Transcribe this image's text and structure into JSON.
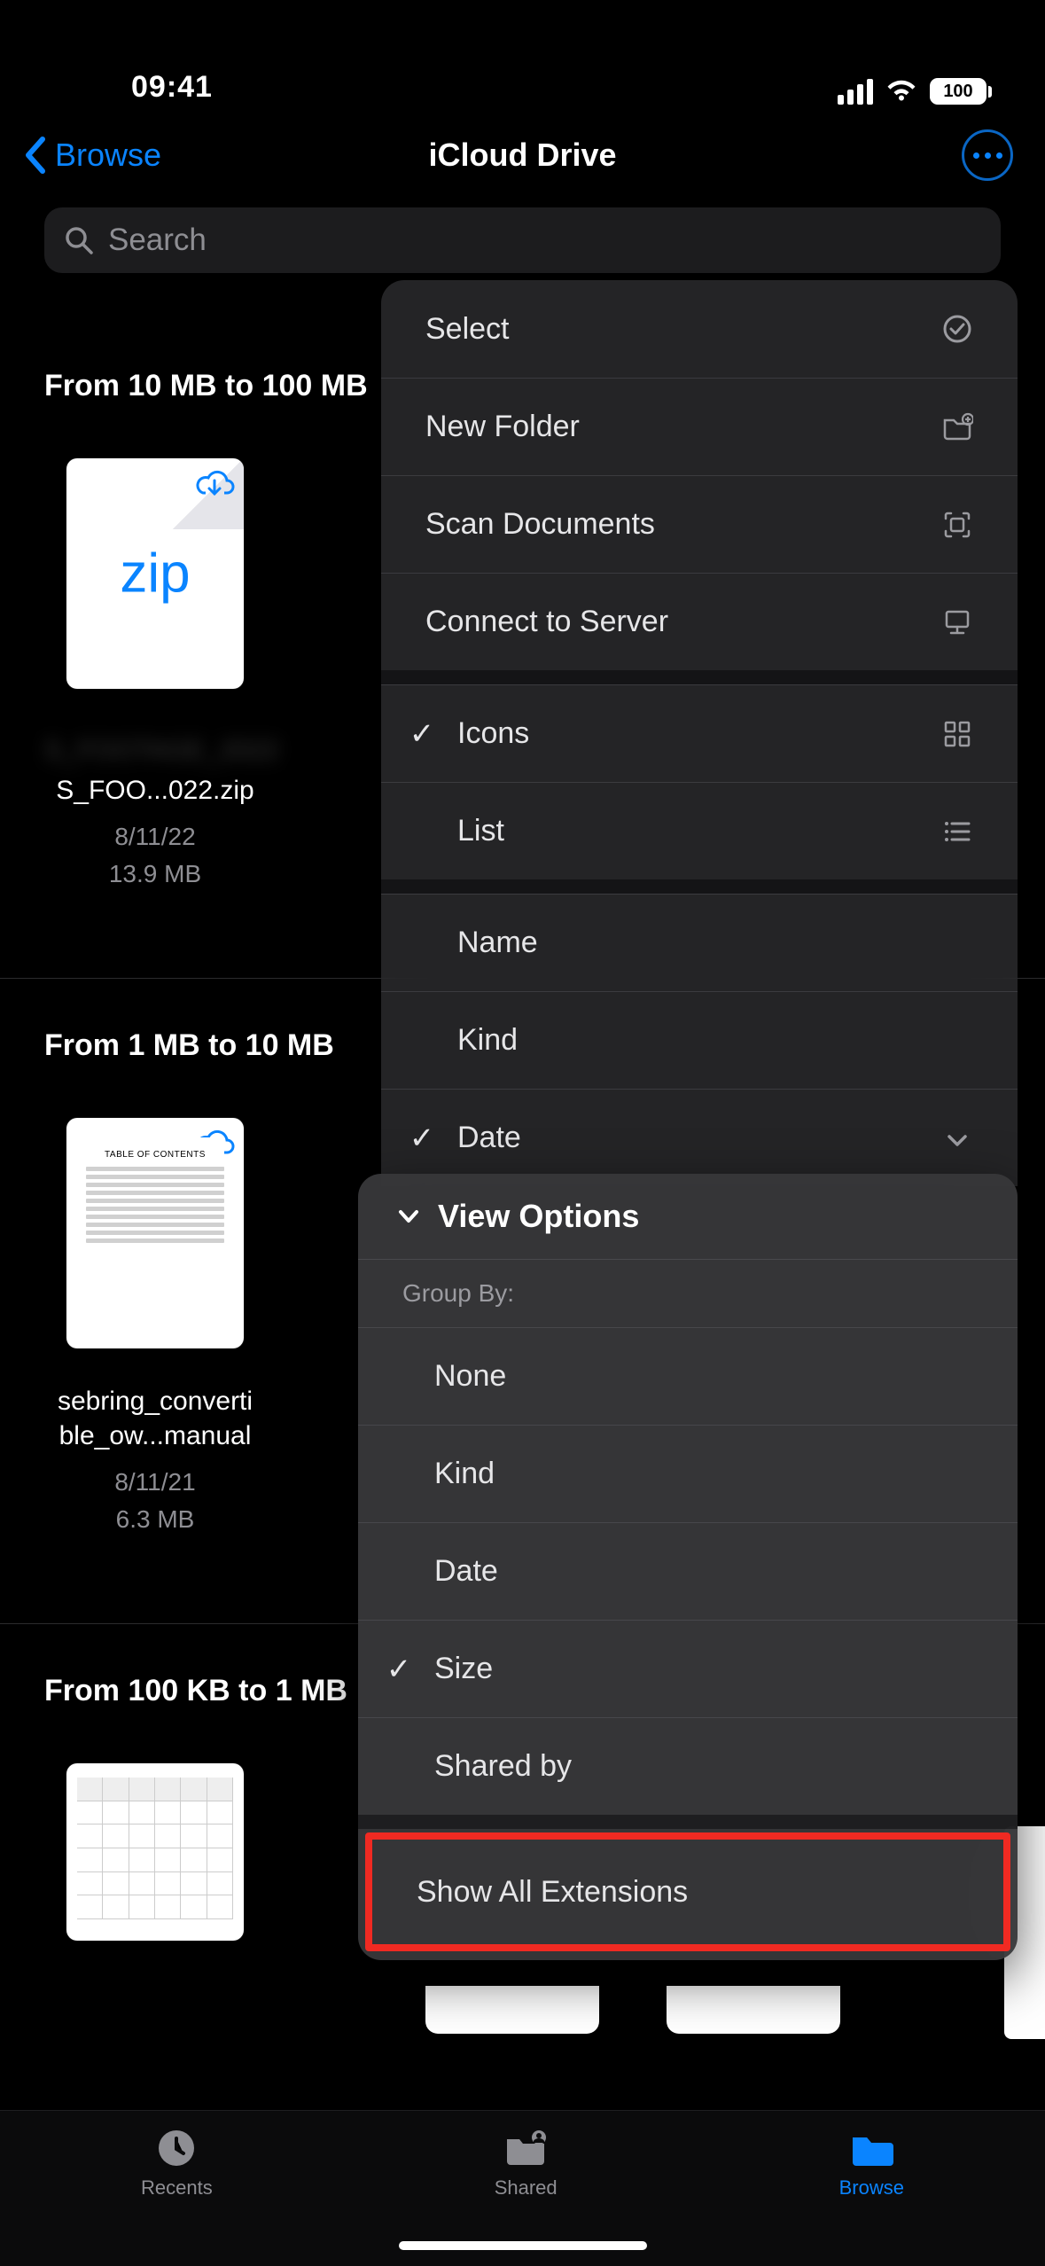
{
  "status": {
    "time": "09:41",
    "battery": "100"
  },
  "nav": {
    "back": "Browse",
    "title": "iCloud Drive"
  },
  "search": {
    "placeholder": "Search"
  },
  "sections": {
    "s1": {
      "title": "From 10 MB to 100 MB"
    },
    "s2": {
      "title": "From 1 MB to 10 MB"
    },
    "s3": {
      "title": "From 100 KB to 1 MB"
    }
  },
  "files": {
    "f1": {
      "name": "S_FOO...022.zip",
      "date": "8/11/22",
      "size": "13.9 MB",
      "zip_label": "zip"
    },
    "f2": {
      "name_line1": "sebring_converti",
      "name_line2": "ble_ow...manual",
      "date": "8/11/21",
      "size": "6.3 MB",
      "thumb_title": "TABLE OF CONTENTS"
    }
  },
  "menu1": {
    "select": "Select",
    "new_folder": "New Folder",
    "scan": "Scan Documents",
    "connect": "Connect to Server",
    "icons": "Icons",
    "list": "List",
    "name": "Name",
    "kind": "Kind",
    "date": "Date"
  },
  "menu2": {
    "header": "View Options",
    "group_by": "Group By:",
    "none": "None",
    "kind": "Kind",
    "date": "Date",
    "size": "Size",
    "shared_by": "Shared by",
    "show_ext": "Show All Extensions"
  },
  "tabs": {
    "recents": "Recents",
    "shared": "Shared",
    "browse": "Browse"
  }
}
